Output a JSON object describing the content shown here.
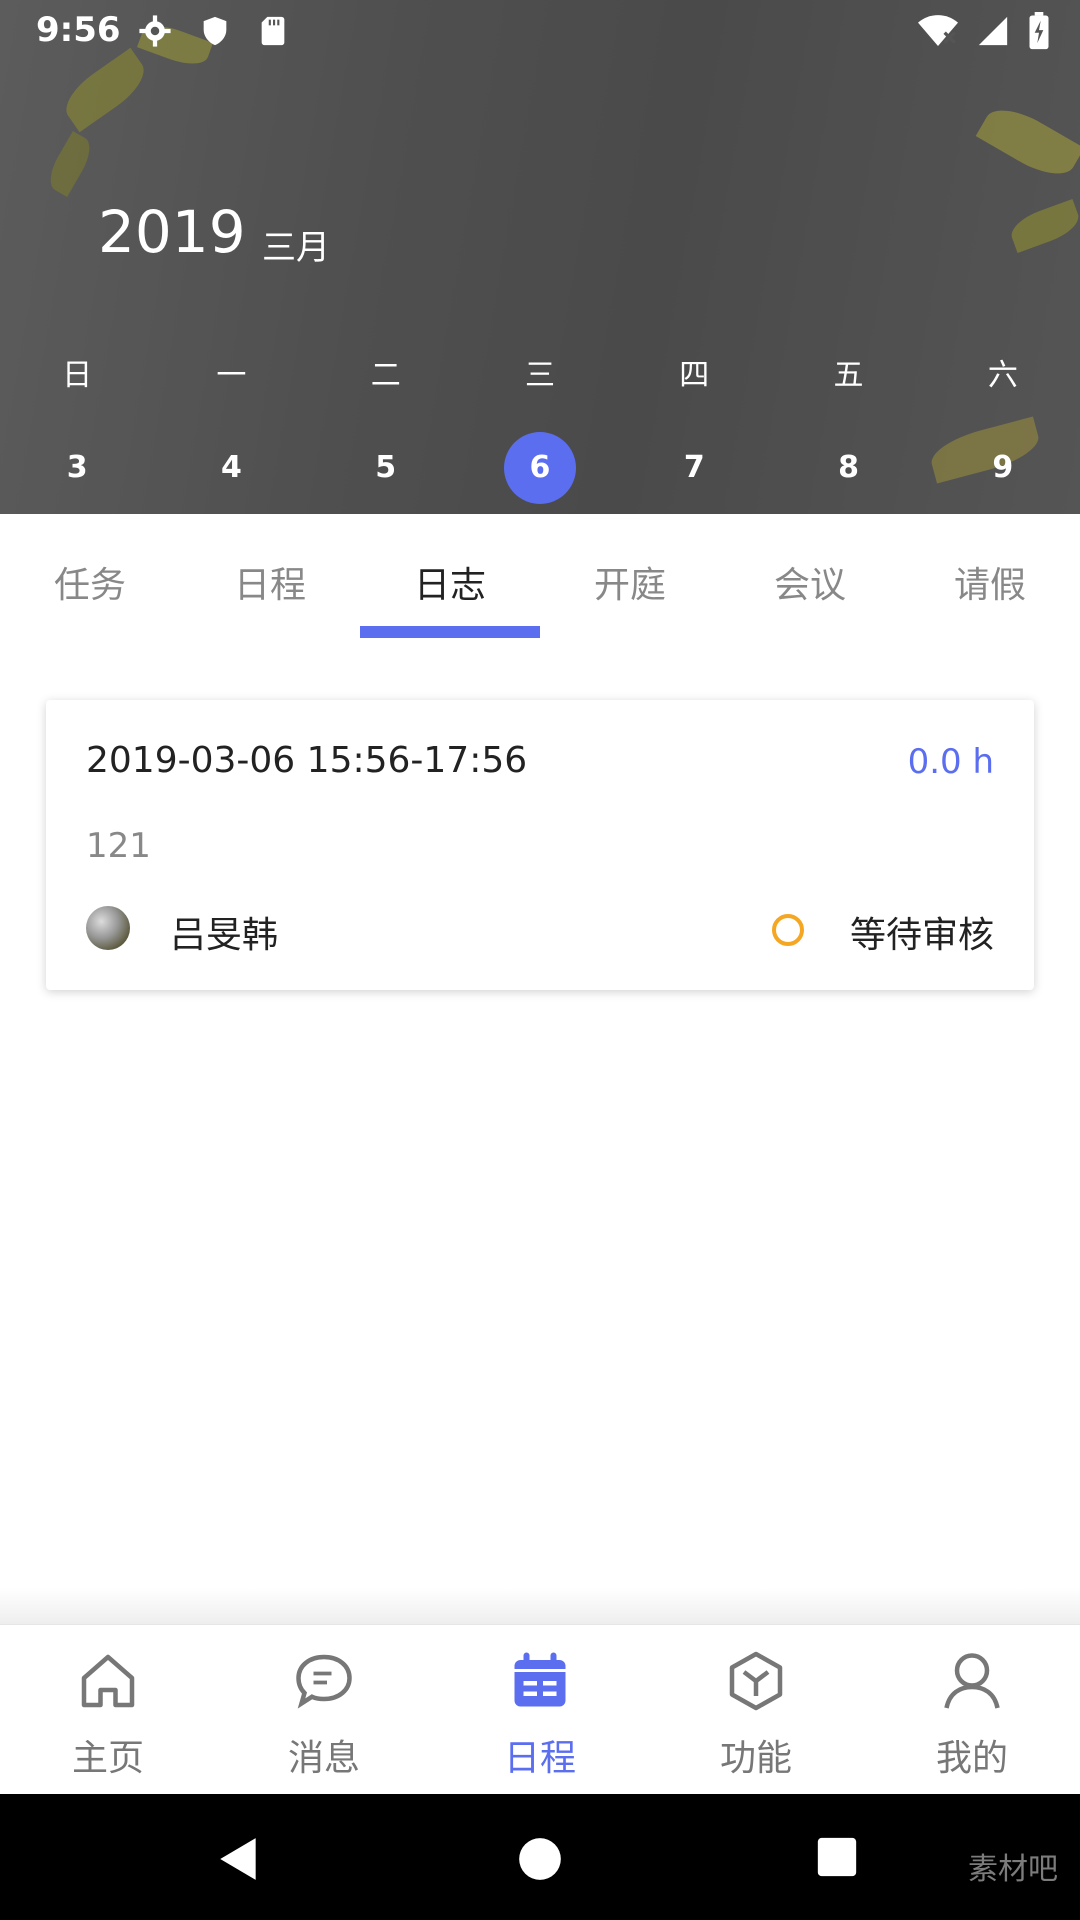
{
  "status_bar": {
    "time": "9:56",
    "left_icons": [
      "gear-icon",
      "shield-icon",
      "sd-card-icon"
    ],
    "right_icons": [
      "wifi-icon",
      "signal-icon",
      "battery-icon"
    ]
  },
  "calendar": {
    "year": "2019",
    "month": "三月",
    "weekdays": [
      "日",
      "一",
      "二",
      "三",
      "四",
      "五",
      "六"
    ],
    "days": [
      "3",
      "4",
      "5",
      "6",
      "7",
      "8",
      "9"
    ],
    "selected_day": "6"
  },
  "tabs": [
    {
      "label": "任务"
    },
    {
      "label": "日程"
    },
    {
      "label": "日志"
    },
    {
      "label": "开庭"
    },
    {
      "label": "会议"
    },
    {
      "label": "请假"
    }
  ],
  "active_tab": "日志",
  "log_card": {
    "datetime": "2019-03-06 15:56-17:56",
    "hours": "0.0 h",
    "content": "121",
    "user": "吕旻韩",
    "status": "等待审核"
  },
  "bottom_nav": [
    {
      "label": "主页",
      "icon": "home-icon"
    },
    {
      "label": "消息",
      "icon": "message-icon"
    },
    {
      "label": "日程",
      "icon": "calendar-icon"
    },
    {
      "label": "功能",
      "icon": "box-icon"
    },
    {
      "label": "我的",
      "icon": "person-icon"
    }
  ],
  "active_nav": "日程",
  "watermark": "素材吧",
  "colors": {
    "accent": "#5b6ef0",
    "pending": "#f5a623"
  }
}
